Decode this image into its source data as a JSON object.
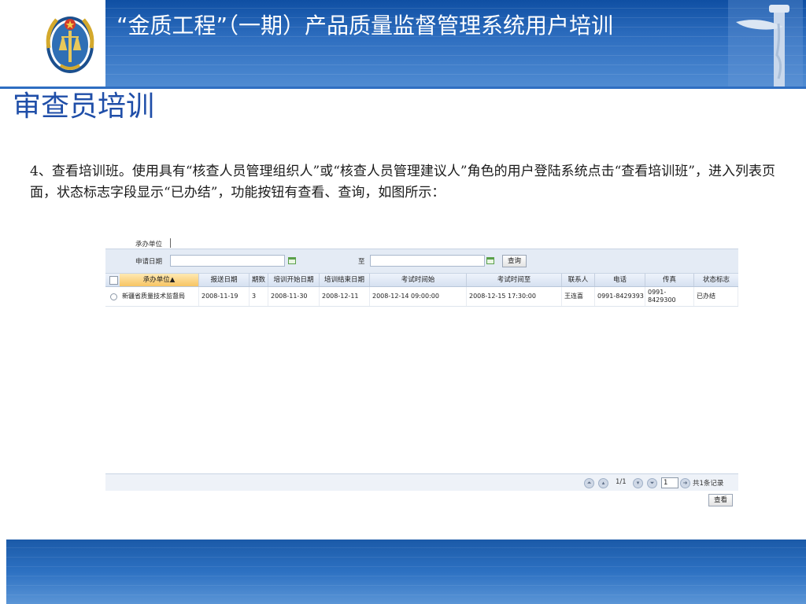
{
  "header": {
    "title": "“金质工程”（一期）产品质量监督管理系统用户培训",
    "emblem_icon": "quality-inspection-emblem-icon",
    "decoration_icon": "huabiao-column-icon"
  },
  "slide": {
    "title": "审查员培训",
    "paragraph": "4、查看培训班。使用具有“核查人员管理组织人”或“核查人员管理建议人”角色的用户登陆系统点击“查看培训班”，进入列表页面，状态标志字段显示“已办结”，功能按钮有查看、查询，如图所示："
  },
  "screenshot": {
    "filter": {
      "org_label": "承办单位",
      "date_label": "申请日期",
      "to_label": "至",
      "query_button": "查询"
    },
    "table": {
      "columns": [
        "承办单位▲",
        "报送日期",
        "期数",
        "培训开始日期",
        "培训结束日期",
        "考试时间始",
        "考试时间至",
        "联系人",
        "电话",
        "传真",
        "状态标志"
      ],
      "rows": [
        {
          "org": "新疆省质量技术监督局",
          "submit_date": "2008-11-19",
          "period": "3",
          "train_start": "2008-11-30",
          "train_end": "2008-12-11",
          "exam_start": "2008-12-14 09:00:00",
          "exam_end": "2008-12-15 17:30:00",
          "contact": "王连喜",
          "phone": "0991-8429393",
          "fax": "0991-8429300",
          "status": "已办结"
        }
      ]
    },
    "pager": {
      "page_info": "1/1",
      "page_input": "1",
      "total": "共1条记录"
    },
    "view_button": "查看"
  },
  "colors": {
    "header_blue": "#2f6fc0",
    "title_blue": "#1f4ea8",
    "footer_blue": "#2d71c2"
  }
}
